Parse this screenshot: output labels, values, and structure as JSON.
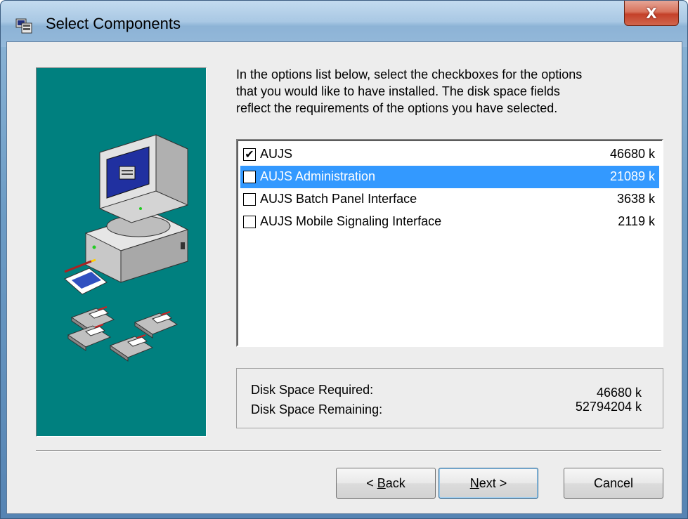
{
  "window": {
    "title": "Select Components",
    "close_glyph": "X",
    "icon": "setup-icon"
  },
  "instructions": "In the options list below, select the checkboxes for the options\nthat you would like to have installed.  The disk space fields\nreflect the requirements of the options you have selected.",
  "components": [
    {
      "label": "AUJS",
      "size": "46680 k",
      "checked": true,
      "selected": false
    },
    {
      "label": "AUJS Administration",
      "size": "21089 k",
      "checked": false,
      "selected": true
    },
    {
      "label": "AUJS Batch Panel Interface",
      "size": "3638 k",
      "checked": false,
      "selected": false
    },
    {
      "label": "AUJS Mobile Signaling Interface",
      "size": "2119 k",
      "checked": false,
      "selected": false
    }
  ],
  "disk": {
    "required_label": "Disk Space Required:",
    "required_value": "46680 k",
    "remaining_label": "Disk Space Remaining:",
    "remaining_value": "52794204 k"
  },
  "buttons": {
    "back_prefix": "< ",
    "back_mnemonic": "B",
    "back_rest": "ack",
    "next_mnemonic": "N",
    "next_rest": "ext >",
    "cancel": "Cancel"
  },
  "colors": {
    "side_panel": "#00807f",
    "selection": "#3399ff",
    "dialog_bg": "#ededed",
    "close_button": "#c4412a"
  },
  "icons": [
    "computer-icon",
    "floppy-disk-icon",
    "notepad-icon",
    "check-icon",
    "close-icon"
  ]
}
